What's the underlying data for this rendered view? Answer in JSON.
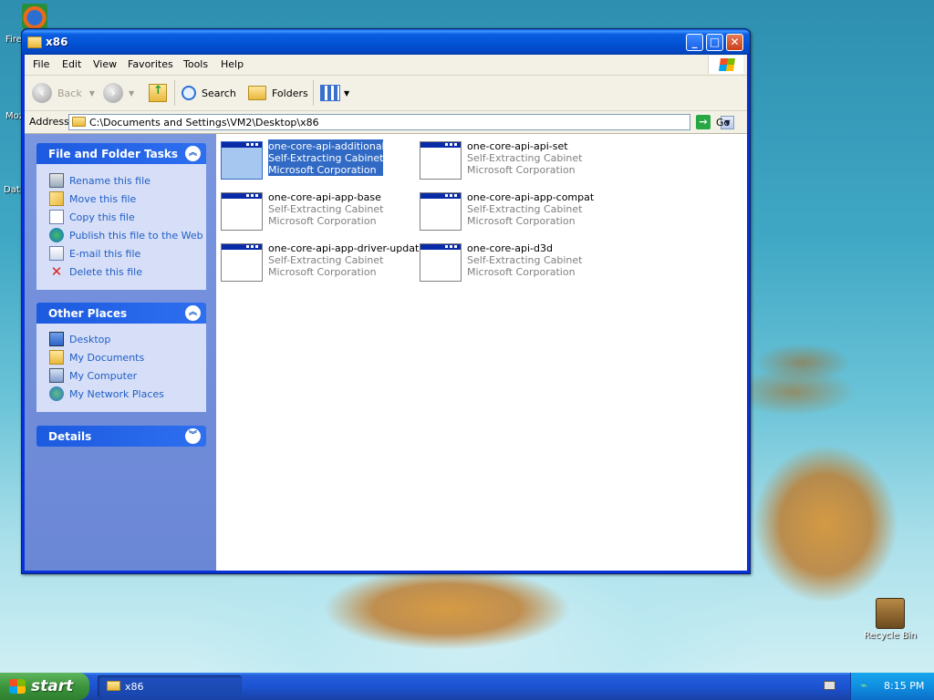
{
  "desktop": {
    "left_icons": [
      "Fire",
      "Moz",
      "Dat"
    ],
    "recycle_bin": "Recycle Bin"
  },
  "window": {
    "title": "x86",
    "menu": [
      "File",
      "Edit",
      "View",
      "Favorites",
      "Tools",
      "Help"
    ],
    "toolbar": {
      "back": "Back",
      "search": "Search",
      "folders": "Folders"
    },
    "address": {
      "label": "Address",
      "path": "C:\\Documents and Settings\\VM2\\Desktop\\x86",
      "go": "Go"
    },
    "panels": {
      "file_tasks": {
        "title": "File and Folder Tasks",
        "items": [
          {
            "label": "Rename this file",
            "icon": "rename-icon"
          },
          {
            "label": "Move this file",
            "icon": "move-icon"
          },
          {
            "label": "Copy this file",
            "icon": "copy-icon"
          },
          {
            "label": "Publish this file to the Web",
            "icon": "publish-icon"
          },
          {
            "label": "E-mail this file",
            "icon": "email-icon"
          },
          {
            "label": "Delete this file",
            "icon": "delete-icon"
          }
        ]
      },
      "other_places": {
        "title": "Other Places",
        "items": [
          {
            "label": "Desktop",
            "icon": "desktop-icon"
          },
          {
            "label": "My Documents",
            "icon": "my-documents-icon"
          },
          {
            "label": "My Computer",
            "icon": "my-computer-icon"
          },
          {
            "label": "My Network Places",
            "icon": "network-places-icon"
          }
        ]
      },
      "details": {
        "title": "Details"
      }
    },
    "files": [
      {
        "name": "one-core-api-additional-dll",
        "type": "Self-Extracting Cabinet",
        "company": "Microsoft Corporation",
        "selected": true
      },
      {
        "name": "one-core-api-api-set",
        "type": "Self-Extracting Cabinet",
        "company": "Microsoft Corporation",
        "selected": false
      },
      {
        "name": "one-core-api-app-base",
        "type": "Self-Extracting Cabinet",
        "company": "Microsoft Corporation",
        "selected": false
      },
      {
        "name": "one-core-api-app-compat",
        "type": "Self-Extracting Cabinet",
        "company": "Microsoft Corporation",
        "selected": false
      },
      {
        "name": "one-core-api-app-driver-update",
        "type": "Self-Extracting Cabinet",
        "company": "Microsoft Corporation",
        "selected": false
      },
      {
        "name": "one-core-api-d3d",
        "type": "Self-Extracting Cabinet",
        "company": "Microsoft Corporation",
        "selected": false
      }
    ]
  },
  "taskbar": {
    "start": "start",
    "task": "x86",
    "time": "8:15 PM"
  },
  "colors": {
    "link_blue": "#215dc6",
    "selection": "#316ac5",
    "xp_blue": "#0831d9"
  }
}
